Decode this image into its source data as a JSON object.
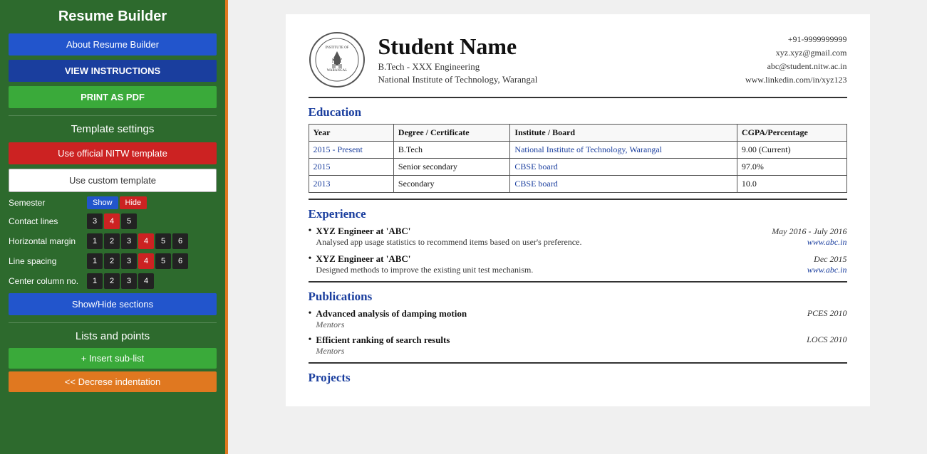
{
  "sidebar": {
    "title": "Resume Builder",
    "about_btn": "About Resume Builder",
    "instructions_btn": "VIEW INSTRUCTIONS",
    "print_btn": "PRINT AS PDF",
    "template_section_title": "Template settings",
    "official_template_btn": "Use official NITW template",
    "custom_template_btn": "Use custom template",
    "semester_label": "Semester",
    "show_label": "Show",
    "hide_label": "Hide",
    "contact_lines_label": "Contact lines",
    "horizontal_margin_label": "Horizontal margin",
    "line_spacing_label": "Line spacing",
    "center_column_label": "Center column no.",
    "show_hide_sections_btn": "Show/Hide sections",
    "lists_section_title": "Lists and points",
    "insert_sublist_btn": "+ Insert sub-list",
    "decrease_indent_btn": "<< Decrese indentation",
    "contact_nums": [
      3,
      4,
      5
    ],
    "contact_active": 4,
    "hmargin_nums": [
      1,
      2,
      3,
      4,
      5,
      6
    ],
    "hmargin_active": 4,
    "linespacing_nums": [
      1,
      2,
      3,
      4,
      5,
      6
    ],
    "linespacing_active": 4,
    "center_col_nums": [
      1,
      2,
      3,
      4
    ],
    "center_col_active": null
  },
  "resume": {
    "student_name": "Student Name",
    "degree": "B.Tech - XXX Engineering",
    "institute": "National Institute of Technology, Warangal",
    "phone": "+91-9999999999",
    "email1": "xyz.xyz@gmail.com",
    "email2": "abc@student.nitw.ac.in",
    "linkedin": "www.linkedin.com/in/xyz123",
    "sections": {
      "education": {
        "title": "Education",
        "table_headers": [
          "Year",
          "Degree / Certificate",
          "Institute / Board",
          "CGPA/Percentage"
        ],
        "rows": [
          {
            "year": "2015 - Present",
            "degree": "B.Tech",
            "institute": "National Institute of Technology, Warangal",
            "cgpa": "9.00 (Current)"
          },
          {
            "year": "2015",
            "degree": "Senior secondary",
            "institute": "CBSE board",
            "cgpa": "97.0%"
          },
          {
            "year": "2013",
            "degree": "Secondary",
            "institute": "CBSE board",
            "cgpa": "10.0"
          }
        ]
      },
      "experience": {
        "title": "Experience",
        "items": [
          {
            "title": "XYZ Engineer at 'ABC'",
            "date": "May 2016 - July 2016",
            "desc": "Analysed app usage statistics to recommend items based on user's preference.",
            "link": "www.abc.in"
          },
          {
            "title": "XYZ Engineer at 'ABC'",
            "date": "Dec 2015",
            "desc": "Designed methods to improve the existing unit test mechanism.",
            "link": "www.abc.in"
          }
        ]
      },
      "publications": {
        "title": "Publications",
        "items": [
          {
            "title": "Advanced analysis of damping motion",
            "venue": "PCES 2010",
            "authors": "Mentors"
          },
          {
            "title": "Efficient ranking of search results",
            "venue": "LOCS 2010",
            "authors": "Mentors"
          }
        ]
      },
      "projects": {
        "title": "Projects"
      }
    }
  }
}
